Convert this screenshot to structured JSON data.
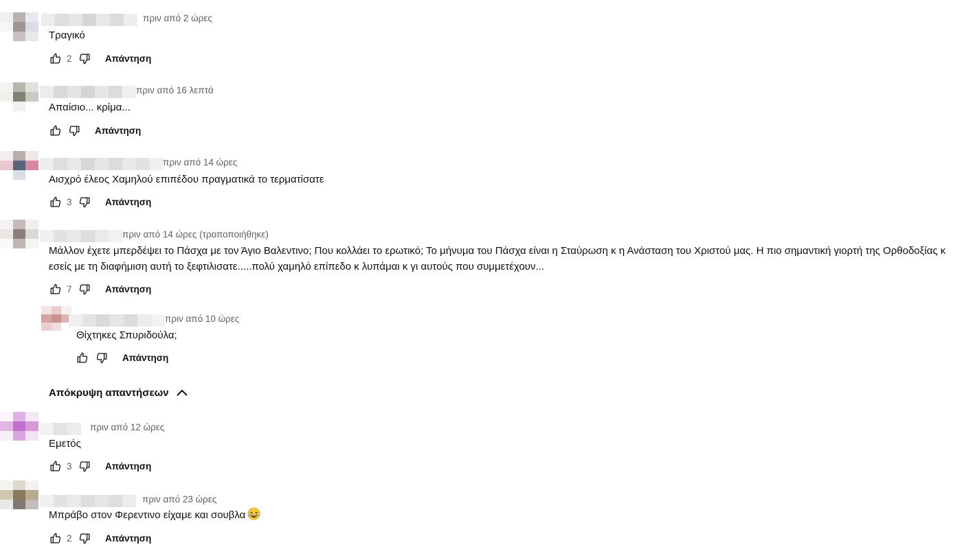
{
  "comments": [
    {
      "time": "πριν από 2 ώρες",
      "text": "Τραγικό",
      "likes": "2",
      "reply_label": "Απάντηση"
    },
    {
      "time": "πριν από 16 λεπτά",
      "text": "Απαίσιο... κρίμα...",
      "likes": "",
      "reply_label": "Απάντηση"
    },
    {
      "time": "πριν από 14 ώρες",
      "text": "Αισχρό έλεος Χαμηλού επιπέδου πραγματικά το τερματίσατε",
      "likes": "3",
      "reply_label": "Απάντηση"
    },
    {
      "time": "πριν από 14 ώρες (τροποποιήθηκε)",
      "text": "Μάλλον έχετε μπερδέψει το Πάσχα με τον Άγιο Βαλεντινο; Που κολλάει το ερωτικό; Το μήνυμα του Πάσχα είναι η Σταύρωση κ η Ανάσταση του Χριστού μας. Η πιο σημαντική γιορτή της Ορθοδοξίας κ εσείς με τη διαφήμιση αυτή το ξεφτιλισατε.....πολύ χαμηλό επίπεδο κ λυπάμαι κ γι αυτούς που συμμετέχουν...",
      "likes": "7",
      "reply_label": "Απάντηση",
      "reply": {
        "time": "πριν από 10 ώρες",
        "text": "Θίχτηκες Σπυριδούλα;",
        "likes": "",
        "reply_label": "Απάντηση"
      }
    },
    {
      "time": "πριν από 12 ώρες",
      "text": "Εμετός",
      "likes": "3",
      "reply_label": "Απάντηση"
    },
    {
      "time": "πριν από 23 ώρες",
      "text": "Μπράβο στον Φερεντινο είχαμε και σουβλα",
      "likes": "2",
      "reply_label": "Απάντηση"
    }
  ],
  "hide_replies_label": "Απόκρυψη απαντήσεων",
  "icons": {
    "like": "thumb-up-icon",
    "dislike": "thumb-down-icon",
    "collapse": "chevron-up-icon",
    "emoji": "laughing-emoji-icon"
  },
  "colors": {
    "text": "#0f0f0f",
    "secondary": "#606060"
  }
}
